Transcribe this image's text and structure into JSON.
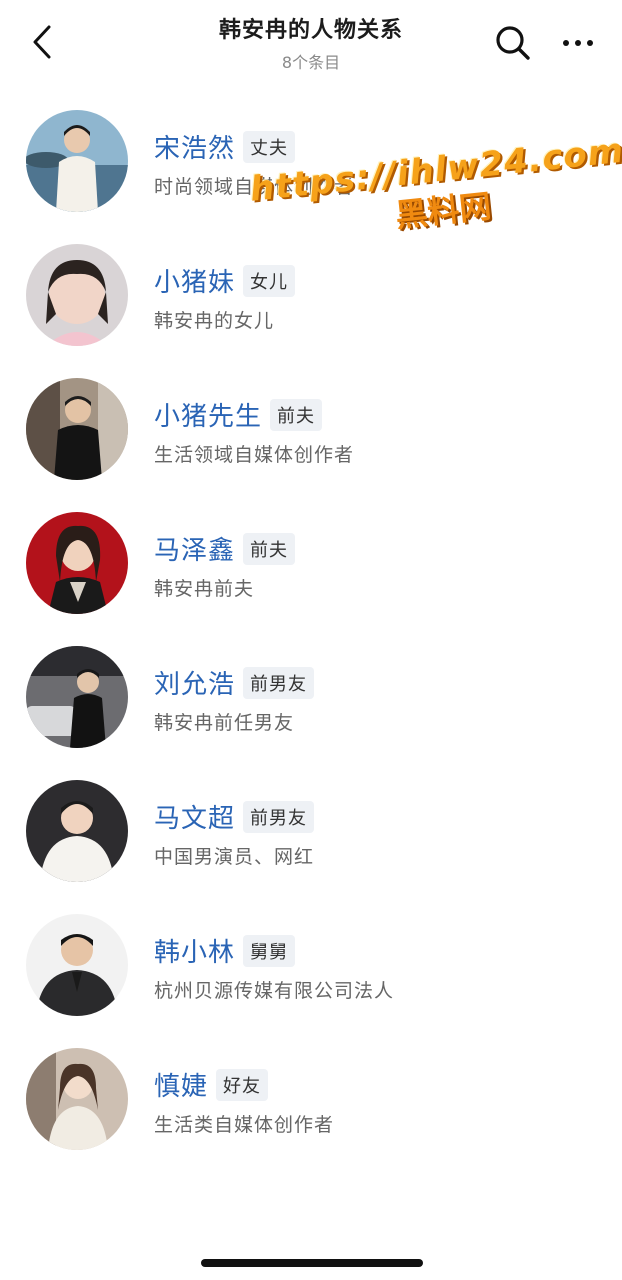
{
  "header": {
    "title": "韩安冉的人物关系",
    "subtitle": "8个条目",
    "back_icon": "chevron-left-icon",
    "search_icon": "search-icon",
    "more_icon": "more-horizontal-icon"
  },
  "items": [
    {
      "name": "宋浩然",
      "relation": "丈夫",
      "desc": "时尚领域自媒体创作者"
    },
    {
      "name": "小猪妹",
      "relation": "女儿",
      "desc": "韩安冉的女儿"
    },
    {
      "name": "小猪先生",
      "relation": "前夫",
      "desc": "生活领域自媒体创作者"
    },
    {
      "name": "马泽鑫",
      "relation": "前夫",
      "desc": "韩安冉前夫"
    },
    {
      "name": "刘允浩",
      "relation": "前男友",
      "desc": "韩安冉前任男友"
    },
    {
      "name": "马文超",
      "relation": "前男友",
      "desc": "中国男演员、网红"
    },
    {
      "name": "韩小林",
      "relation": "舅舅",
      "desc": "杭州贝源传媒有限公司法人"
    },
    {
      "name": "慎婕",
      "relation": "好友",
      "desc": "生活类自媒体创作者"
    }
  ],
  "watermark": {
    "url": "https://ihlw24.com",
    "label": "黑料网"
  },
  "colors": {
    "name_blue": "#2a64b5",
    "tag_bg": "#eef1f5",
    "watermark_orange": "#f6a21a"
  }
}
